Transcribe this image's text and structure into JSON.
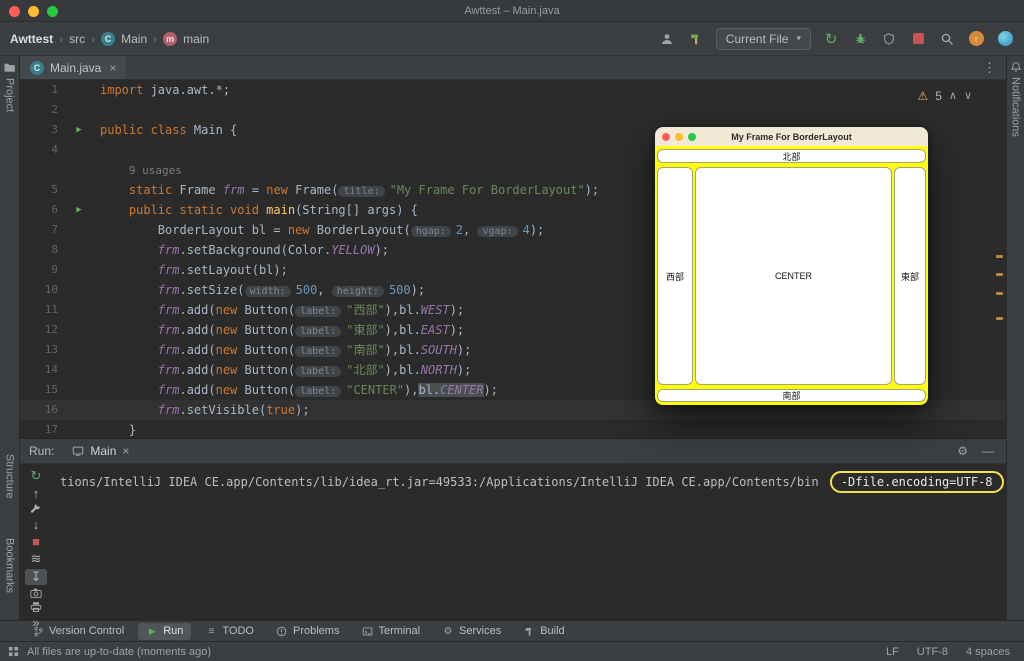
{
  "window": {
    "title": "Awttest – Main.java"
  },
  "breadcrumbs": {
    "items": [
      "Awttest",
      "src",
      "Main",
      "main"
    ]
  },
  "toolbar": {
    "run_config": "Current File"
  },
  "editor_tabs": {
    "active": "Main.java"
  },
  "inspection": {
    "warnings": "5"
  },
  "icons": {
    "user": "person-silhouette",
    "build-hammer": "hammer",
    "run": "circular-arrow",
    "debug": "bug",
    "coverage": "shield",
    "stop": "red-square",
    "search": "magnifier",
    "update": "orange-circle-up-arrow",
    "collab": "teal-circle",
    "settings": "gear",
    "hide": "minus-line",
    "warning": "yellow-triangle",
    "project": "folder",
    "notifications": "bell",
    "version-control": "branch",
    "terminal": "monitor",
    "todo": "list-lines",
    "problems": "exclamation-circle",
    "services": "gear",
    "class": "circle-C",
    "method": "circle-m",
    "more": "double-chevron"
  },
  "editor": {
    "lines": [
      {
        "n": "1",
        "tokens": [
          [
            "kw",
            "import"
          ],
          [
            "pl",
            " java.awt.*;"
          ]
        ]
      },
      {
        "n": "2",
        "tokens": []
      },
      {
        "n": "3",
        "run": true,
        "tokens": [
          [
            "kw",
            "public class "
          ],
          [
            "pl",
            "Main {"
          ]
        ]
      },
      {
        "n": "4",
        "tokens": []
      },
      {
        "n": "",
        "inlay": true,
        "tokens": [
          [
            "pl",
            "    "
          ],
          [
            "usages",
            "9 usages"
          ]
        ]
      },
      {
        "n": "5",
        "tokens": [
          [
            "pl",
            "    "
          ],
          [
            "kw",
            "static"
          ],
          [
            "pl",
            " Frame "
          ],
          [
            "fld",
            "frm"
          ],
          [
            "pl",
            " = "
          ],
          [
            "kw",
            "new"
          ],
          [
            "pl",
            " Frame("
          ],
          [
            "hint",
            "title:"
          ],
          [
            "str",
            "\"My Frame For BorderLayout\""
          ],
          [
            "pl",
            ");"
          ]
        ]
      },
      {
        "n": "6",
        "run": true,
        "tokens": [
          [
            "kw",
            "    public static void "
          ],
          [
            "dec",
            "main"
          ],
          [
            "pl",
            "(String[] args) {"
          ]
        ]
      },
      {
        "n": "7",
        "tokens": [
          [
            "pl",
            "        BorderLayout bl = "
          ],
          [
            "kw",
            "new"
          ],
          [
            "pl",
            " BorderLayout("
          ],
          [
            "hint",
            "hgap:"
          ],
          [
            "num",
            "2"
          ],
          [
            "pl",
            ", "
          ],
          [
            "hint",
            "vgap:"
          ],
          [
            "num",
            "4"
          ],
          [
            "pl",
            ");"
          ]
        ]
      },
      {
        "n": "8",
        "tokens": [
          [
            "pl",
            "        "
          ],
          [
            "fld",
            "frm"
          ],
          [
            "pl",
            ".setBackground(Color."
          ],
          [
            "cst",
            "YELLOW"
          ],
          [
            "pl",
            ");"
          ]
        ]
      },
      {
        "n": "9",
        "tokens": [
          [
            "pl",
            "        "
          ],
          [
            "fld",
            "frm"
          ],
          [
            "pl",
            ".setLayout(bl);"
          ]
        ]
      },
      {
        "n": "10",
        "tokens": [
          [
            "pl",
            "        "
          ],
          [
            "fld",
            "frm"
          ],
          [
            "pl",
            ".setSize("
          ],
          [
            "hint",
            "width:"
          ],
          [
            "num",
            "500"
          ],
          [
            "pl",
            ", "
          ],
          [
            "hint",
            "height:"
          ],
          [
            "num",
            "500"
          ],
          [
            "pl",
            ");"
          ]
        ]
      },
      {
        "n": "11",
        "tokens": [
          [
            "pl",
            "        "
          ],
          [
            "fld",
            "frm"
          ],
          [
            "pl",
            ".add("
          ],
          [
            "kw",
            "new"
          ],
          [
            "pl",
            " Button("
          ],
          [
            "hint",
            "label:"
          ],
          [
            "str",
            "\"西部\""
          ],
          [
            "pl",
            "),bl."
          ],
          [
            "cst",
            "WEST"
          ],
          [
            "pl",
            ");"
          ]
        ]
      },
      {
        "n": "12",
        "tokens": [
          [
            "pl",
            "        "
          ],
          [
            "fld",
            "frm"
          ],
          [
            "pl",
            ".add("
          ],
          [
            "kw",
            "new"
          ],
          [
            "pl",
            " Button("
          ],
          [
            "hint",
            "label:"
          ],
          [
            "str",
            "\"東部\""
          ],
          [
            "pl",
            "),bl."
          ],
          [
            "cst",
            "EAST"
          ],
          [
            "pl",
            ");"
          ]
        ]
      },
      {
        "n": "13",
        "tokens": [
          [
            "pl",
            "        "
          ],
          [
            "fld",
            "frm"
          ],
          [
            "pl",
            ".add("
          ],
          [
            "kw",
            "new"
          ],
          [
            "pl",
            " Button("
          ],
          [
            "hint",
            "label:"
          ],
          [
            "str",
            "\"南部\""
          ],
          [
            "pl",
            "),bl."
          ],
          [
            "cst",
            "SOUTH"
          ],
          [
            "pl",
            ");"
          ]
        ]
      },
      {
        "n": "14",
        "tokens": [
          [
            "pl",
            "        "
          ],
          [
            "fld",
            "frm"
          ],
          [
            "pl",
            ".add("
          ],
          [
            "kw",
            "new"
          ],
          [
            "pl",
            " Button("
          ],
          [
            "hint",
            "label:"
          ],
          [
            "str",
            "\"北部\""
          ],
          [
            "pl",
            "),bl."
          ],
          [
            "cst",
            "NORTH"
          ],
          [
            "pl",
            ");"
          ]
        ]
      },
      {
        "n": "15",
        "tokens": [
          [
            "pl",
            "        "
          ],
          [
            "fld",
            "frm"
          ],
          [
            "pl",
            ".add("
          ],
          [
            "kw",
            "new"
          ],
          [
            "pl",
            " Button("
          ],
          [
            "hint",
            "label:"
          ],
          [
            "str",
            "\"CENTER\""
          ],
          [
            "pl",
            "),"
          ],
          [
            "plh",
            "bl."
          ],
          [
            "csth",
            "CENTER"
          ],
          [
            "pl",
            ");"
          ]
        ]
      },
      {
        "n": "16",
        "caret": true,
        "tokens": [
          [
            "pl",
            "        "
          ],
          [
            "fld",
            "frm"
          ],
          [
            "pl",
            ".setVisible("
          ],
          [
            "kw",
            "true"
          ],
          [
            "pl",
            ");"
          ]
        ]
      },
      {
        "n": "17",
        "tokens": [
          [
            "pl",
            "    }"
          ]
        ]
      }
    ]
  },
  "awt_frame": {
    "title": "My Frame For BorderLayout",
    "buttons": {
      "north": "北部",
      "west": "西部",
      "center": "CENTER",
      "east": "東部",
      "south": "南部"
    },
    "background": "#ffff00"
  },
  "run_panel": {
    "label": "Run:",
    "tab": "Main",
    "console_prefix": "tions/IntelliJ IDEA CE.app/Contents/lib/idea_rt.jar=49533:/Applications/IntelliJ IDEA CE.app/Contents/bin ",
    "console_highlight": "-Dfile.encoding=UTF-8",
    "toolbar": [
      {
        "name": "rerun"
      },
      {
        "name": "up"
      },
      {
        "name": "wrench"
      },
      {
        "name": "down"
      },
      {
        "name": "stop"
      },
      {
        "name": "soft-wrap"
      },
      {
        "name": "scroll-end",
        "selected": true
      },
      {
        "name": "camera"
      },
      {
        "name": "print"
      },
      {
        "name": "more"
      }
    ]
  },
  "tool_windows": {
    "project_label": "Project",
    "structure_label": "Structure",
    "bookmarks_label": "Bookmarks",
    "notifications_label": "Notifications",
    "bottom": [
      {
        "label": "Version Control",
        "icon": "branch"
      },
      {
        "label": "Run",
        "icon": "play",
        "active": true
      },
      {
        "label": "TODO",
        "icon": "todo"
      },
      {
        "label": "Problems",
        "icon": "problems"
      },
      {
        "label": "Terminal",
        "icon": "terminal"
      },
      {
        "label": "Services",
        "icon": "services"
      },
      {
        "label": "Build",
        "icon": "build"
      }
    ]
  },
  "status_bar": {
    "message": "All files are up-to-date (moments ago)",
    "line_sep": "LF",
    "encoding": "UTF-8",
    "indent": "4 spaces"
  }
}
